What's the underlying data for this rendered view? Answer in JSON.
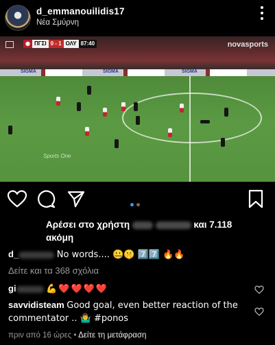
{
  "post": {
    "username": "d_emmanouilidis17",
    "location": "Νέα Σμύρνη"
  },
  "video": {
    "scorebug": {
      "team_home": "ΠΓΣΙ",
      "score": "0 - 1",
      "team_away": "ΟΛΥ",
      "time": "87:40"
    },
    "broadcaster": "novasports",
    "ad_text": "SIGMA",
    "channel_tag": "Sports One"
  },
  "carousel": {
    "count": 2,
    "active": 1
  },
  "likes": {
    "prefix": "Αρέσει στο χρήστη",
    "suffix": "και 7.118",
    "suffix2": "ακόμη"
  },
  "caption": {
    "username": "d_",
    "text": "No words.... 🤐🤫 7️⃣7️⃣ 🔥🔥"
  },
  "view_comments": "Δείτε και τα 368 σχόλια",
  "comments": [
    {
      "username": "gi",
      "text": "💪❤️❤️❤️❤️"
    },
    {
      "username": "savvidisteam",
      "text": "Good goal, even better reaction of the commentator .. 🤷‍♂️ #ponos"
    }
  ],
  "footer": {
    "time_ago": "πριν από 16 ώρες",
    "separator": "•",
    "translate": "Δείτε τη μετάφραση"
  },
  "colors": {
    "accent_dot": "#3897f0",
    "heart_red": "#e3263a"
  }
}
